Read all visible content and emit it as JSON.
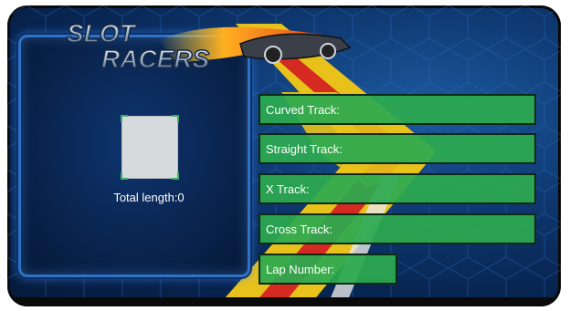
{
  "app": {
    "logo_line1": "SLOT",
    "logo_line2": "RACERS"
  },
  "preview": {
    "total_length_label": "Total length:",
    "total_length_value": "0",
    "total_length_text": "Total length:0"
  },
  "fields": [
    {
      "label": "Curved Track:"
    },
    {
      "label": "Straight Track:"
    },
    {
      "label": "X Track:"
    },
    {
      "label": "Cross Track:"
    },
    {
      "label": "Lap Number:"
    }
  ],
  "colors": {
    "field_green": "#2caa50",
    "panel_border": "#2f72c4",
    "stripe_yellow": "#e8c21a",
    "stripe_red": "#d42a22",
    "background_blue": "#0f3a73"
  }
}
